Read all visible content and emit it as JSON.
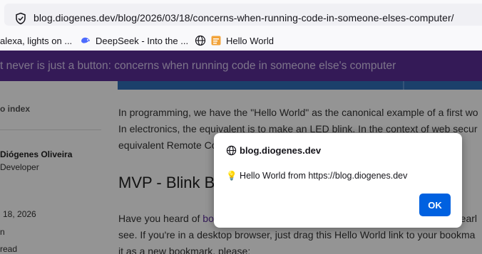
{
  "browser": {
    "url": "blog.diogenes.dev/blog/2026/03/18/concerns-when-running-code-in-someone-elses-computer/",
    "bookmarks": [
      {
        "label": "alexa, lights on ...",
        "icon": "bookmark-icon"
      },
      {
        "label": "DeepSeek - Into the ...",
        "icon": "deepseek-icon"
      },
      {
        "label": "Hello World",
        "icon": "globe-icon"
      }
    ]
  },
  "page": {
    "header_title": "t never is just a button: concerns when running code in someone else's computer",
    "sidebar": {
      "back_link": "o index",
      "author_name": "Diógenes Oliveira",
      "author_role": "Developer",
      "date": "18, 2026",
      "meta1": "n",
      "meta2": "read"
    },
    "article": {
      "para1_line1": "In programming, we have the \"Hello World\" as the canonical example of a first wo",
      "para1_line2": "In electronics, the equivalent is to make an LED blink. In the context of web secur",
      "para1_line3": "equivalent Remote Co",
      "heading": "MVP - Blink Bo",
      "para2_pre": "Have you heard of ",
      "para2_link": "bo",
      "para2_post": "e earl",
      "para2_line2": "see. If you're in a desktop browser, just drag this Hello World link to your bookma",
      "para2_line3": "it as a new bookmark, please:"
    }
  },
  "dialog": {
    "title": "blog.diogenes.dev",
    "message": "💡 Hello World from https://blog.diogenes.dev",
    "ok_label": "OK"
  },
  "colors": {
    "purple_header": "#5b2d96",
    "ok_button": "#0061e0",
    "link": "#5b2d96"
  }
}
